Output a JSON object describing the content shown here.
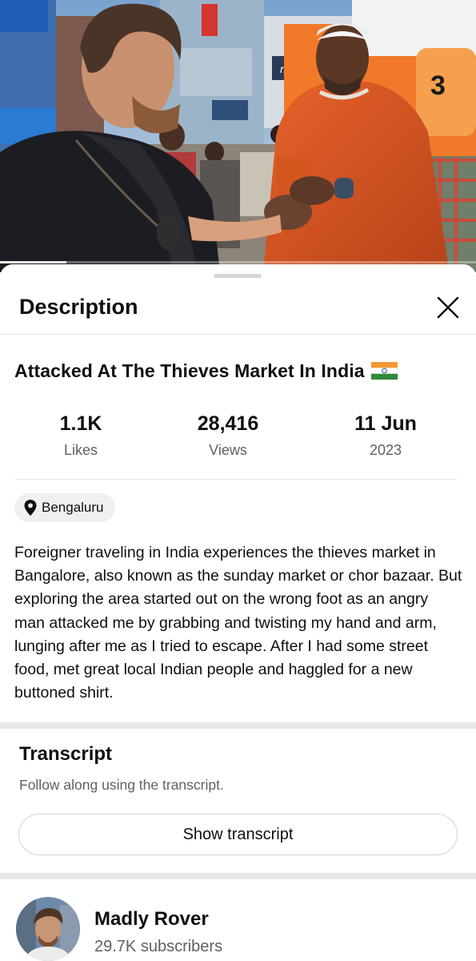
{
  "video": {
    "progress": 0.14,
    "scene_sign": "3",
    "shop_sign": "magne"
  },
  "sheet": {
    "title": "Description",
    "close_icon": "close-icon"
  },
  "details": {
    "title": "Attacked At The Thieves Market In India",
    "flag_icon": "india-flag-icon",
    "stats": [
      {
        "value": "1.1K",
        "label": "Likes"
      },
      {
        "value": "28,416",
        "label": "Views"
      },
      {
        "value": "11 Jun",
        "label": "2023"
      }
    ],
    "location": {
      "icon": "location-pin-icon",
      "label": "Bengaluru"
    },
    "description": "Foreigner traveling in India experiences the thieves market in Bangalore, also known as the sunday market or chor bazaar. But exploring the area started out on the wrong foot as an angry man attacked me by grabbing and twisting my hand and arm, lunging after me as I tried to escape. After I had some street food, met great local Indian people and haggled for a new buttoned shirt."
  },
  "transcript": {
    "title": "Transcript",
    "subtitle": "Follow along using the transcript.",
    "button_label": "Show transcript"
  },
  "channel": {
    "name": "Madly Rover",
    "subscribers": "29.7K subscribers"
  },
  "colors": {
    "text_primary": "#0f0f0f",
    "text_secondary": "#606060",
    "chip_bg": "#f0f0f0",
    "divider": "#e8e8e8"
  }
}
